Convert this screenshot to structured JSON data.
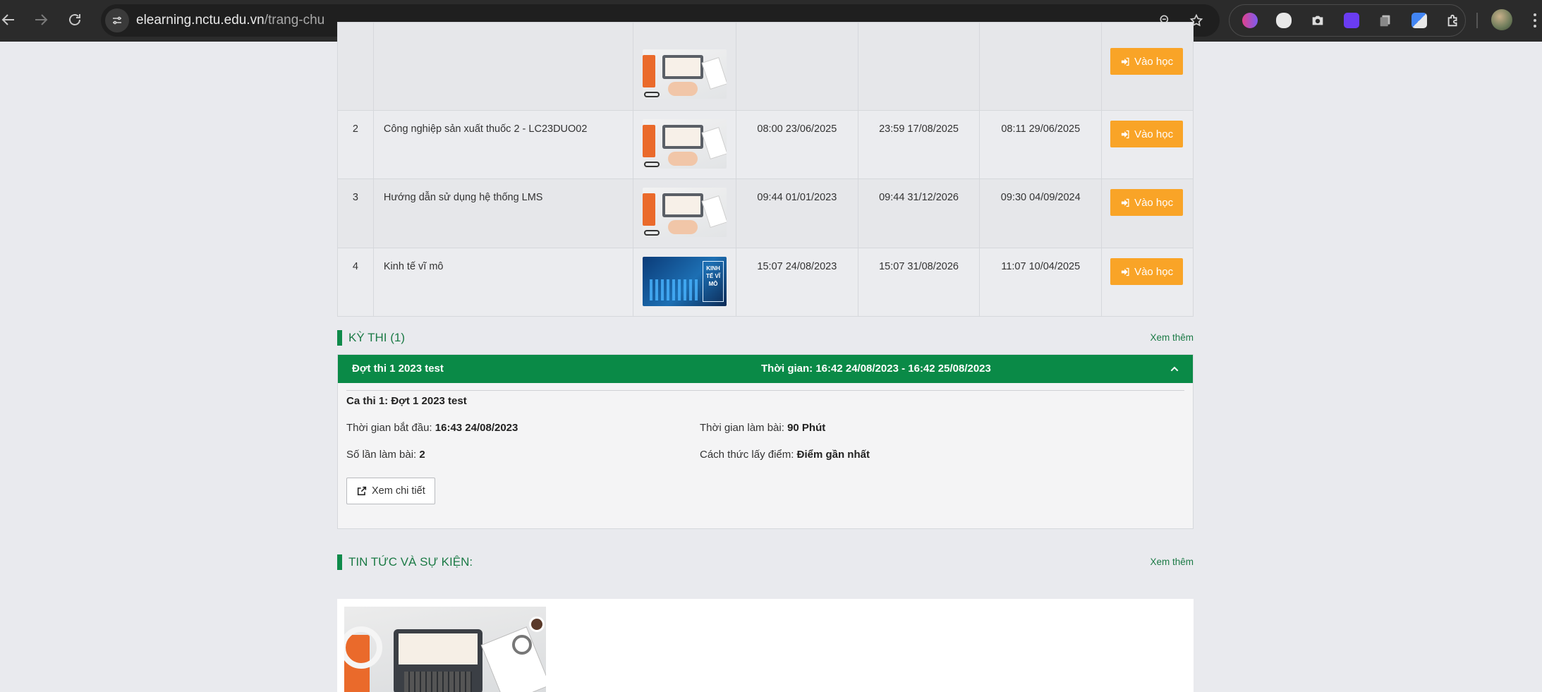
{
  "browser": {
    "url_host": "elearning.nctu.edu.vn",
    "url_path": "/trang-chu",
    "extensions": [
      "brain-extension-icon",
      "cloud-extension-icon",
      "camera-extension-icon",
      "gear-extension-icon",
      "copy-extension-icon",
      "translate-extension-icon",
      "puzzle-extensions-icon"
    ]
  },
  "courses": {
    "action_label": "Vào học",
    "rows": [
      {
        "num": "",
        "name": "",
        "thumb": "laptop",
        "start": "",
        "end": "",
        "last": ""
      },
      {
        "num": "2",
        "name": "Công nghiệp sản xuất thuốc 2 - LC23DUO02",
        "thumb": "laptop",
        "start": "08:00 23/06/2025",
        "end": "23:59 17/08/2025",
        "last": "08:11 29/06/2025"
      },
      {
        "num": "3",
        "name": "Hướng dẫn sử dụng hệ thống LMS",
        "thumb": "laptop",
        "start": "09:44 01/01/2023",
        "end": "09:44 31/12/2026",
        "last": "09:30 04/09/2024"
      },
      {
        "num": "4",
        "name": "Kinh tế vĩ mô",
        "thumb": "macro",
        "start": "15:07 24/08/2023",
        "end": "15:07 31/08/2026",
        "last": "11:07 10/04/2025"
      }
    ],
    "macro_thumb_text": "KINH TẾ VĨ MÔ"
  },
  "exams": {
    "title": "KỲ THI (1)",
    "more": "Xem thêm",
    "batch_name": "Đợt thi 1 2023 test",
    "batch_time": "Thời gian: 16:42 24/08/2023 - 16:42 25/08/2023",
    "session_label": "Ca thi  1: Đợt 1 2023 test",
    "start_label": "Thời gian bắt đầu:",
    "start_value": "16:43 24/08/2023",
    "duration_label": "Thời gian làm bài:",
    "duration_value": "90 Phút",
    "attempts_label": "Số lần làm bài:",
    "attempts_value": "2",
    "scoring_label": "Cách thức lấy điểm:",
    "scoring_value": "Điểm gần nhất",
    "detail_button": "Xem chi tiết"
  },
  "news": {
    "title": "TIN TỨC VÀ SỰ KIỆN:",
    "more": "Xem thêm"
  },
  "colors": {
    "accent_green": "#0a8a47",
    "action_orange": "#f9a427",
    "page_bg": "#e9eaee"
  }
}
